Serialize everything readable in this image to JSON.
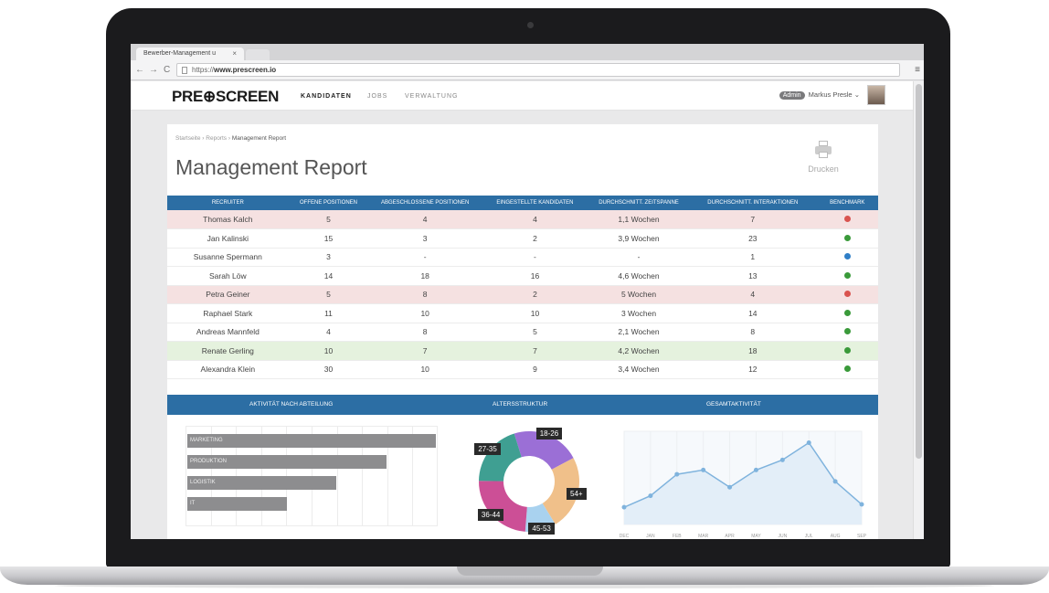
{
  "browser": {
    "tab_title": "Bewerber-Management u",
    "tab_close": "×",
    "back": "←",
    "forward": "→",
    "reload": "C",
    "url_protocol": "https://",
    "url_host": "www.prescreen.io",
    "menu": "≡"
  },
  "app": {
    "logo": "PRE⊕SCREEN",
    "nav": [
      "KANDIDATEN",
      "JOBS",
      "VERWALTUNG"
    ],
    "admin_badge": "Admin",
    "user_name": "Markus Presle",
    "user_caret": "⌄"
  },
  "page": {
    "breadcrumb": [
      "Startseite",
      "Reports",
      "Management Report"
    ],
    "breadcrumb_sep": "›",
    "title": "Management Report",
    "print_label": "Drucken"
  },
  "table": {
    "headers": [
      "Recruiter",
      "Offene Positionen",
      "Abgeschlossene Positionen",
      "Eingestellte Kandidaten",
      "Durchschnitt. Zeitspanne",
      "Durchschnitt. Interaktionen",
      "Benchmark"
    ],
    "rows": [
      {
        "name": "Thomas Kalch",
        "open": "5",
        "closed": "4",
        "hired": "4",
        "time": "1,1 Wochen",
        "interactions": "7",
        "status": "red"
      },
      {
        "name": "Jan Kalinski",
        "open": "15",
        "closed": "3",
        "hired": "2",
        "time": "3,9 Wochen",
        "interactions": "23",
        "status": "green"
      },
      {
        "name": "Susanne Spermann",
        "open": "3",
        "closed": "-",
        "hired": "-",
        "time": "-",
        "interactions": "1",
        "status": "blue"
      },
      {
        "name": "Sarah Löw",
        "open": "14",
        "closed": "18",
        "hired": "16",
        "time": "4,6 Wochen",
        "interactions": "13",
        "status": "green"
      },
      {
        "name": "Petra Geiner",
        "open": "5",
        "closed": "8",
        "hired": "2",
        "time": "5 Wochen",
        "interactions": "4",
        "status": "red"
      },
      {
        "name": "Raphael Stark",
        "open": "11",
        "closed": "10",
        "hired": "10",
        "time": "3 Wochen",
        "interactions": "14",
        "status": "green"
      },
      {
        "name": "Andreas Mannfeld",
        "open": "4",
        "closed": "8",
        "hired": "5",
        "time": "2,1 Wochen",
        "interactions": "8",
        "status": "green"
      },
      {
        "name": "Renate Gerling",
        "open": "10",
        "closed": "7",
        "hired": "7",
        "time": "4,2 Wochen",
        "interactions": "18",
        "status": "green"
      },
      {
        "name": "Alexandra Klein",
        "open": "30",
        "closed": "10",
        "hired": "9",
        "time": "3,4 Wochen",
        "interactions": "12",
        "status": "green"
      }
    ],
    "row_highlight": {
      "0": "red",
      "4": "red",
      "7": "green"
    }
  },
  "colors": {
    "header_blue": "#2c6ea4",
    "red": "#d9534f",
    "green": "#3a9a3a",
    "blue": "#2f7fc7"
  },
  "charts_header": [
    "Aktivität nach Abteilung",
    "Altersstruktur",
    "Gesamtaktivität"
  ],
  "chart_data": [
    {
      "type": "bar",
      "orientation": "horizontal",
      "categories": [
        "MARKETING",
        "PRODUKTION",
        "LOGISTIK",
        "IT"
      ],
      "values": [
        100,
        80,
        60,
        40
      ],
      "xlim": [
        0,
        100
      ],
      "grid": true
    },
    {
      "type": "pie",
      "donut": true,
      "labels": [
        "18-26",
        "54+",
        "45-53",
        "36-44",
        "27-35"
      ],
      "values": [
        22,
        24,
        10,
        24,
        20
      ],
      "colors": [
        "#9b6fd6",
        "#f0c08a",
        "#a9d2ef",
        "#cc4f96",
        "#3f9f92"
      ]
    },
    {
      "type": "area",
      "categories": [
        "DEC",
        "JAN",
        "FEB",
        "MAR",
        "APR",
        "MAY",
        "JUN",
        "JUL",
        "AUG",
        "SEP"
      ],
      "values": [
        12,
        20,
        35,
        38,
        26,
        38,
        45,
        57,
        30,
        14
      ],
      "ylim": [
        0,
        65
      ],
      "color": "#7fb3dd"
    }
  ]
}
